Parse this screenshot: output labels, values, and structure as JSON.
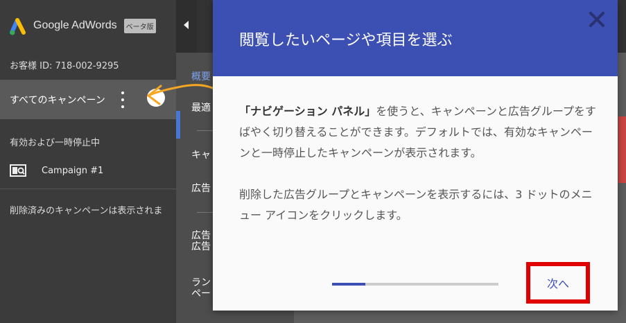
{
  "app": {
    "logo_text": "Google AdWords",
    "beta_badge": "ベータ版"
  },
  "sidebar": {
    "account_id": "お客様 ID: 718-002-9295",
    "all_campaigns": "すべてのキャンペーン",
    "status_filter": "有効および一時停止中",
    "campaigns": [
      {
        "name": "Campaign #1",
        "icon": "campaign-icon"
      }
    ],
    "deleted_note": "削除済みのキャンペーンは表示されま"
  },
  "nav": {
    "items": [
      "概要",
      "最適",
      "キャ",
      "広告",
      "広告\n広告",
      "ラン\nペー"
    ]
  },
  "dialog": {
    "title": "閲覧したいページや項目を選ぶ",
    "para1_bold": "「ナビゲーション パネル」",
    "para1_rest": "を使うと、キャンペーンと広告グループをすばやく切り替えることができます。デフォルトでは、有効なキャンペーンと一時停止したキャンペーンが表示されます。",
    "para2": "削除した広告グループとキャンペーンを表示するには、3 ドットのメニュー アイコンをクリックします。",
    "progress": 0.2,
    "next_label": "次へ"
  },
  "colors": {
    "header": "#3c4fb2",
    "highlight": "#e00000",
    "arrow": "#f5a623"
  }
}
